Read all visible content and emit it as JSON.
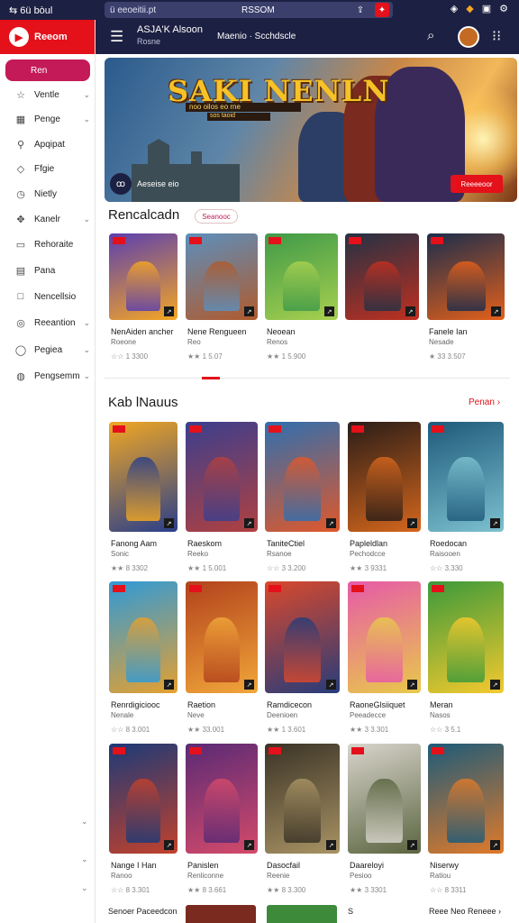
{
  "status": {
    "left": "⇆ 6ü bòul",
    "address": "ü eeoeitii.pt",
    "address_mid": "RSSOM",
    "icons": [
      "wifi-icon",
      "bell-icon",
      "battery-icon",
      "settings-icon"
    ]
  },
  "brand": {
    "name": "Reeom"
  },
  "sidebar": {
    "items": [
      {
        "label": "Ren",
        "icon": "home-icon",
        "active": true
      },
      {
        "label": "Ventle",
        "icon": "star-icon",
        "chevron": true
      },
      {
        "label": "Penge",
        "icon": "grid-icon",
        "chevron": true
      },
      {
        "label": "Apqipat",
        "icon": "link-icon"
      },
      {
        "label": "Ffgie",
        "icon": "tag-icon"
      },
      {
        "label": "Nietly",
        "icon": "clock-icon"
      },
      {
        "label": "Kanelr",
        "icon": "puzzle-icon",
        "chevron": true
      },
      {
        "label": "Rehoraite",
        "icon": "tv-icon"
      },
      {
        "label": "Pana",
        "icon": "doc-icon"
      },
      {
        "label": "Nencellsio",
        "icon": "box-icon"
      },
      {
        "label": "Reeantion",
        "icon": "gamepad-icon",
        "chevron": true
      },
      {
        "label": "Pegiea",
        "icon": "user-icon",
        "chevron": true
      },
      {
        "label": "Pengsemm",
        "icon": "globe-icon",
        "chevron": true
      }
    ]
  },
  "topbar": {
    "title": "ASJA'K Alsoon",
    "subtitle": "Rosne",
    "nav": "Maenio · Scchdscle"
  },
  "hero": {
    "title": "SAKI NENLN",
    "tag1": "noo oilos eo rne",
    "tag2": "sos taoid",
    "badge": "ꝏ",
    "caption": "Aeseise eio",
    "cta": "Reeeeoor"
  },
  "sections": {
    "recommended": {
      "title": "Rencalcadn",
      "pill": "Seanooc"
    },
    "hot": {
      "title": "Kab lNauus",
      "see_all": "Penan ›"
    }
  },
  "row1": [
    {
      "name": "NenAiden ancher",
      "sub": "Roeone",
      "rating": "☆☆ 1 3300",
      "color": "#5b3fb0",
      "c2": "#f5a623"
    },
    {
      "name": "Nene Rengueen",
      "sub": "Reo",
      "rating": "★★ 1 5.07",
      "color": "#5c8fbd",
      "c2": "#b05a2c"
    },
    {
      "name": "Neoean",
      "sub": "Renos",
      "rating": "★★ 1 5.900",
      "color": "#3f9a48",
      "c2": "#a8d04f"
    },
    {
      "name": "",
      "sub": "",
      "rating": "",
      "color": "#233144",
      "c2": "#c03020"
    },
    {
      "name": "Fanele Ian",
      "sub": "Nesade",
      "rating": "★ 33 3.507",
      "color": "#1b2d4c",
      "c2": "#e4601a"
    }
  ],
  "row2": [
    {
      "name": "Fanong Aam",
      "sub": "Sonic",
      "rating": "★★ 8 3302",
      "color": "#f1a723",
      "c2": "#2a3f8a"
    },
    {
      "name": "Raeskom",
      "sub": "Reeko",
      "rating": "★★ 1 5.001",
      "color": "#3b3f8e",
      "c2": "#b04040"
    },
    {
      "name": "TaniteCtiel",
      "sub": "Rsanoe",
      "rating": "☆☆ 3 3.200",
      "color": "#2e6fb0",
      "c2": "#e0582a"
    },
    {
      "name": "Papleldlan",
      "sub": "Pechodcce",
      "rating": "★★ 3 9331",
      "color": "#2a1d18",
      "c2": "#d4661c"
    },
    {
      "name": "Roedocan",
      "sub": "Raisooen",
      "rating": "☆☆ 3.330",
      "color": "#1e5a7a",
      "c2": "#7dc1d0"
    }
  ],
  "row3": [
    {
      "name": "Renrdigiciooc",
      "sub": "Nenale",
      "rating": "☆☆ 8 3.001",
      "color": "#2f9ad8",
      "c2": "#e5a030"
    },
    {
      "name": "Raetion",
      "sub": "Neve",
      "rating": "★★ 33.001",
      "color": "#b2421c",
      "c2": "#f1a63a"
    },
    {
      "name": "Ramdicecon",
      "sub": "Deenioen",
      "rating": "★★ 1 3.601",
      "color": "#d9482c",
      "c2": "#273c7a"
    },
    {
      "name": "RaoneGlsiiquet",
      "sub": "Peeadecce",
      "rating": "★★ 3 3.301",
      "color": "#e75aa8",
      "c2": "#e8c94a"
    },
    {
      "name": "Meran",
      "sub": "Nasos",
      "rating": "☆☆ 3 5.1",
      "color": "#3c9a3a",
      "c2": "#f4c92e"
    }
  ],
  "row4": [
    {
      "name": "Nange I Han",
      "sub": "Ranoo",
      "rating": "☆☆ 8 3.301",
      "color": "#1c3a78",
      "c2": "#c2412c"
    },
    {
      "name": "Panislen",
      "sub": "Renliconne",
      "rating": "★★ 8 3.661",
      "color": "#5a2a75",
      "c2": "#d44a6a"
    },
    {
      "name": "Dasocfail",
      "sub": "Reenie",
      "rating": "★★ 8 3.300",
      "color": "#3a3326",
      "c2": "#a99364"
    },
    {
      "name": "Daareloyi",
      "sub": "Pesioo",
      "rating": "★★ 3 3301",
      "color": "#d8d4cc",
      "c2": "#5b6540"
    },
    {
      "name": "Niserwy",
      "sub": "Ratiou",
      "rating": "☆☆ 8 3311",
      "color": "#1d5b7a",
      "c2": "#e07a2a"
    }
  ],
  "footer": {
    "left": "Senoer Paceedcon",
    "right": "Reee Neo Reneee ›",
    "mid": "S"
  }
}
